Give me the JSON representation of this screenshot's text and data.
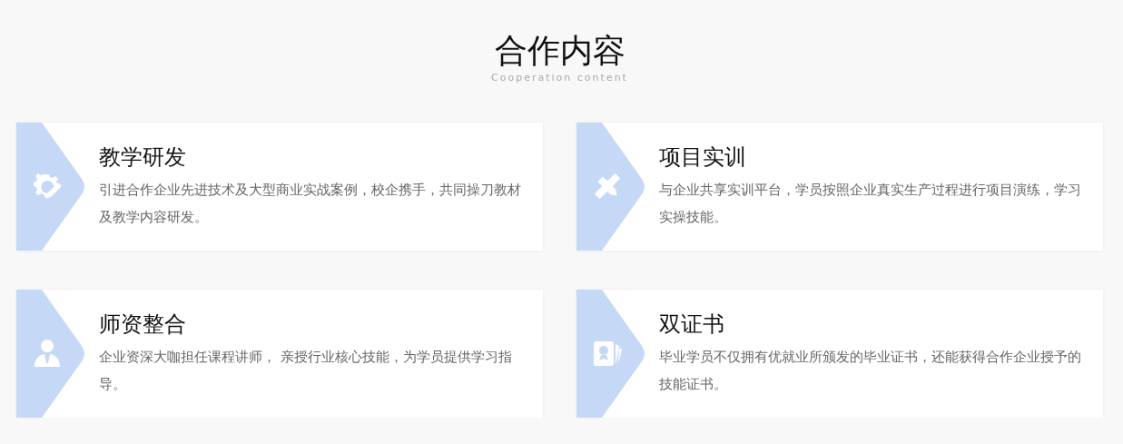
{
  "header": {
    "title": "合作内容",
    "subtitle": "Cooperation content"
  },
  "cards": [
    {
      "kind": "research",
      "title": "教学研发",
      "description": "引进合作企业先进技术及大型商业实战案例，校企携手，共同操刀教材及教学内容研发。"
    },
    {
      "kind": "training",
      "title": "项目实训",
      "description": "与企业共享实训平台，学员按照企业真实生产过程进行项目演练，学习实操技能。"
    },
    {
      "kind": "teachers",
      "title": "师资整合",
      "description": "企业资深大咖担任课程讲师， 亲授行业核心技能，为学员提供学习指导。"
    },
    {
      "kind": "certificate",
      "title": "双证书",
      "description": "毕业学员不仅拥有优就业所颁发的毕业证书，还能获得合作企业授予的技能证书。"
    }
  ]
}
